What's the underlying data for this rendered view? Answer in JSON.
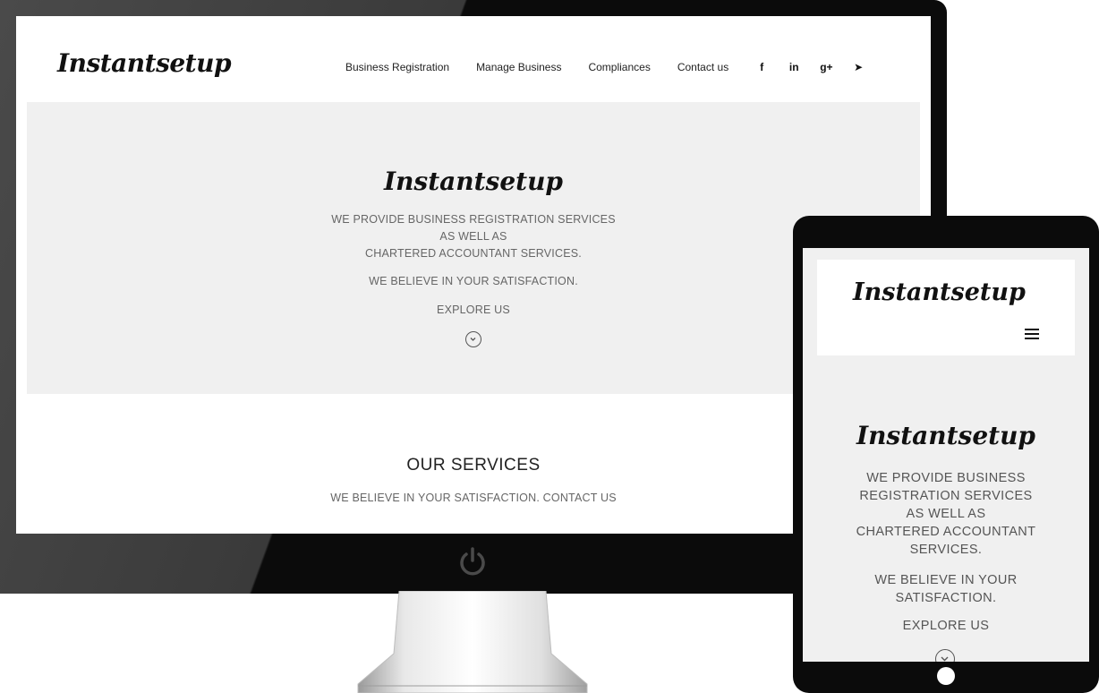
{
  "brand": {
    "name": "Instantsetup"
  },
  "desktop": {
    "nav": [
      {
        "label": "Business Registration"
      },
      {
        "label": "Manage Business"
      },
      {
        "label": "Compliances"
      },
      {
        "label": "Contact us"
      }
    ],
    "social_icons": [
      {
        "icon": "facebook-icon",
        "glyph": "f"
      },
      {
        "icon": "linkedin-icon",
        "glyph": "in"
      },
      {
        "icon": "google-plus-icon",
        "glyph": "g+"
      },
      {
        "icon": "telegram-icon",
        "glyph": "➤"
      }
    ],
    "hero": {
      "line1": "WE PROVIDE BUSINESS REGISTRATION SERVICES",
      "line2": "AS WELL AS",
      "line3": "CHARTERED ACCOUNTANT SERVICES.",
      "satisfaction": "WE BELIEVE IN YOUR SATISFACTION.",
      "explore": "EXPLORE US"
    },
    "services": {
      "title": "OUR SERVICES",
      "subtitle": "WE BELIEVE IN YOUR SATISFACTION. CONTACT US"
    }
  },
  "tablet": {
    "hero": {
      "line1": "WE PROVIDE BUSINESS",
      "line2": "REGISTRATION SERVICES",
      "line3": "AS WELL AS",
      "line4": "CHARTERED ACCOUNTANT",
      "line5": "SERVICES.",
      "sat1": "WE BELIEVE IN YOUR",
      "sat2": "SATISFACTION.",
      "explore": "EXPLORE US"
    }
  },
  "colors": {
    "frame": "#0b0b0b",
    "hero_bg": "#f0f0f0",
    "text_muted": "#666666"
  }
}
